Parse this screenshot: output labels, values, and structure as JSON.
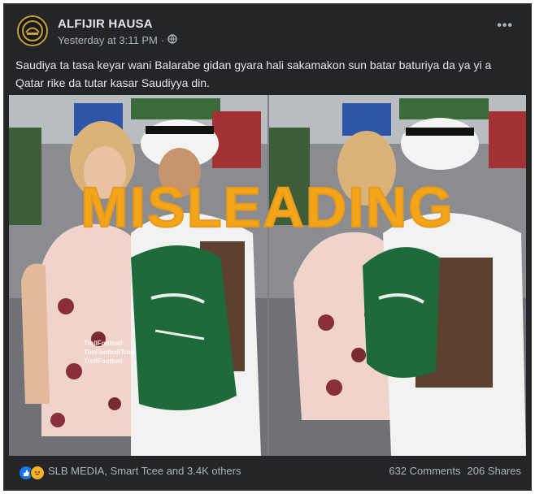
{
  "post": {
    "page_name": "ALFIJIR HAUSA",
    "timestamp": "Yesterday at 3:11 PM",
    "separator": "·",
    "audience_icon": "globe-icon",
    "more_icon": "ellipsis-icon",
    "caption": "Saudiya ta tasa keyar wani Balarabe  gidan gyara hali sakamakon sun batar baturiya da ya yi a Qatar rike da tutar kasar Saudiyya din."
  },
  "media": {
    "label": "MISLEADING",
    "label_color": "#f3a51a",
    "watermark": [
      "TrollFootball",
      "TheFootballTroll",
      "TrollFootball"
    ]
  },
  "footer": {
    "reaction_icons": [
      "like-icon",
      "haha-icon"
    ],
    "reactions_text": "SLB MEDIA, Smart Tcee and 3.4K others",
    "comments": "632 Comments",
    "shares": "206 Shares"
  }
}
